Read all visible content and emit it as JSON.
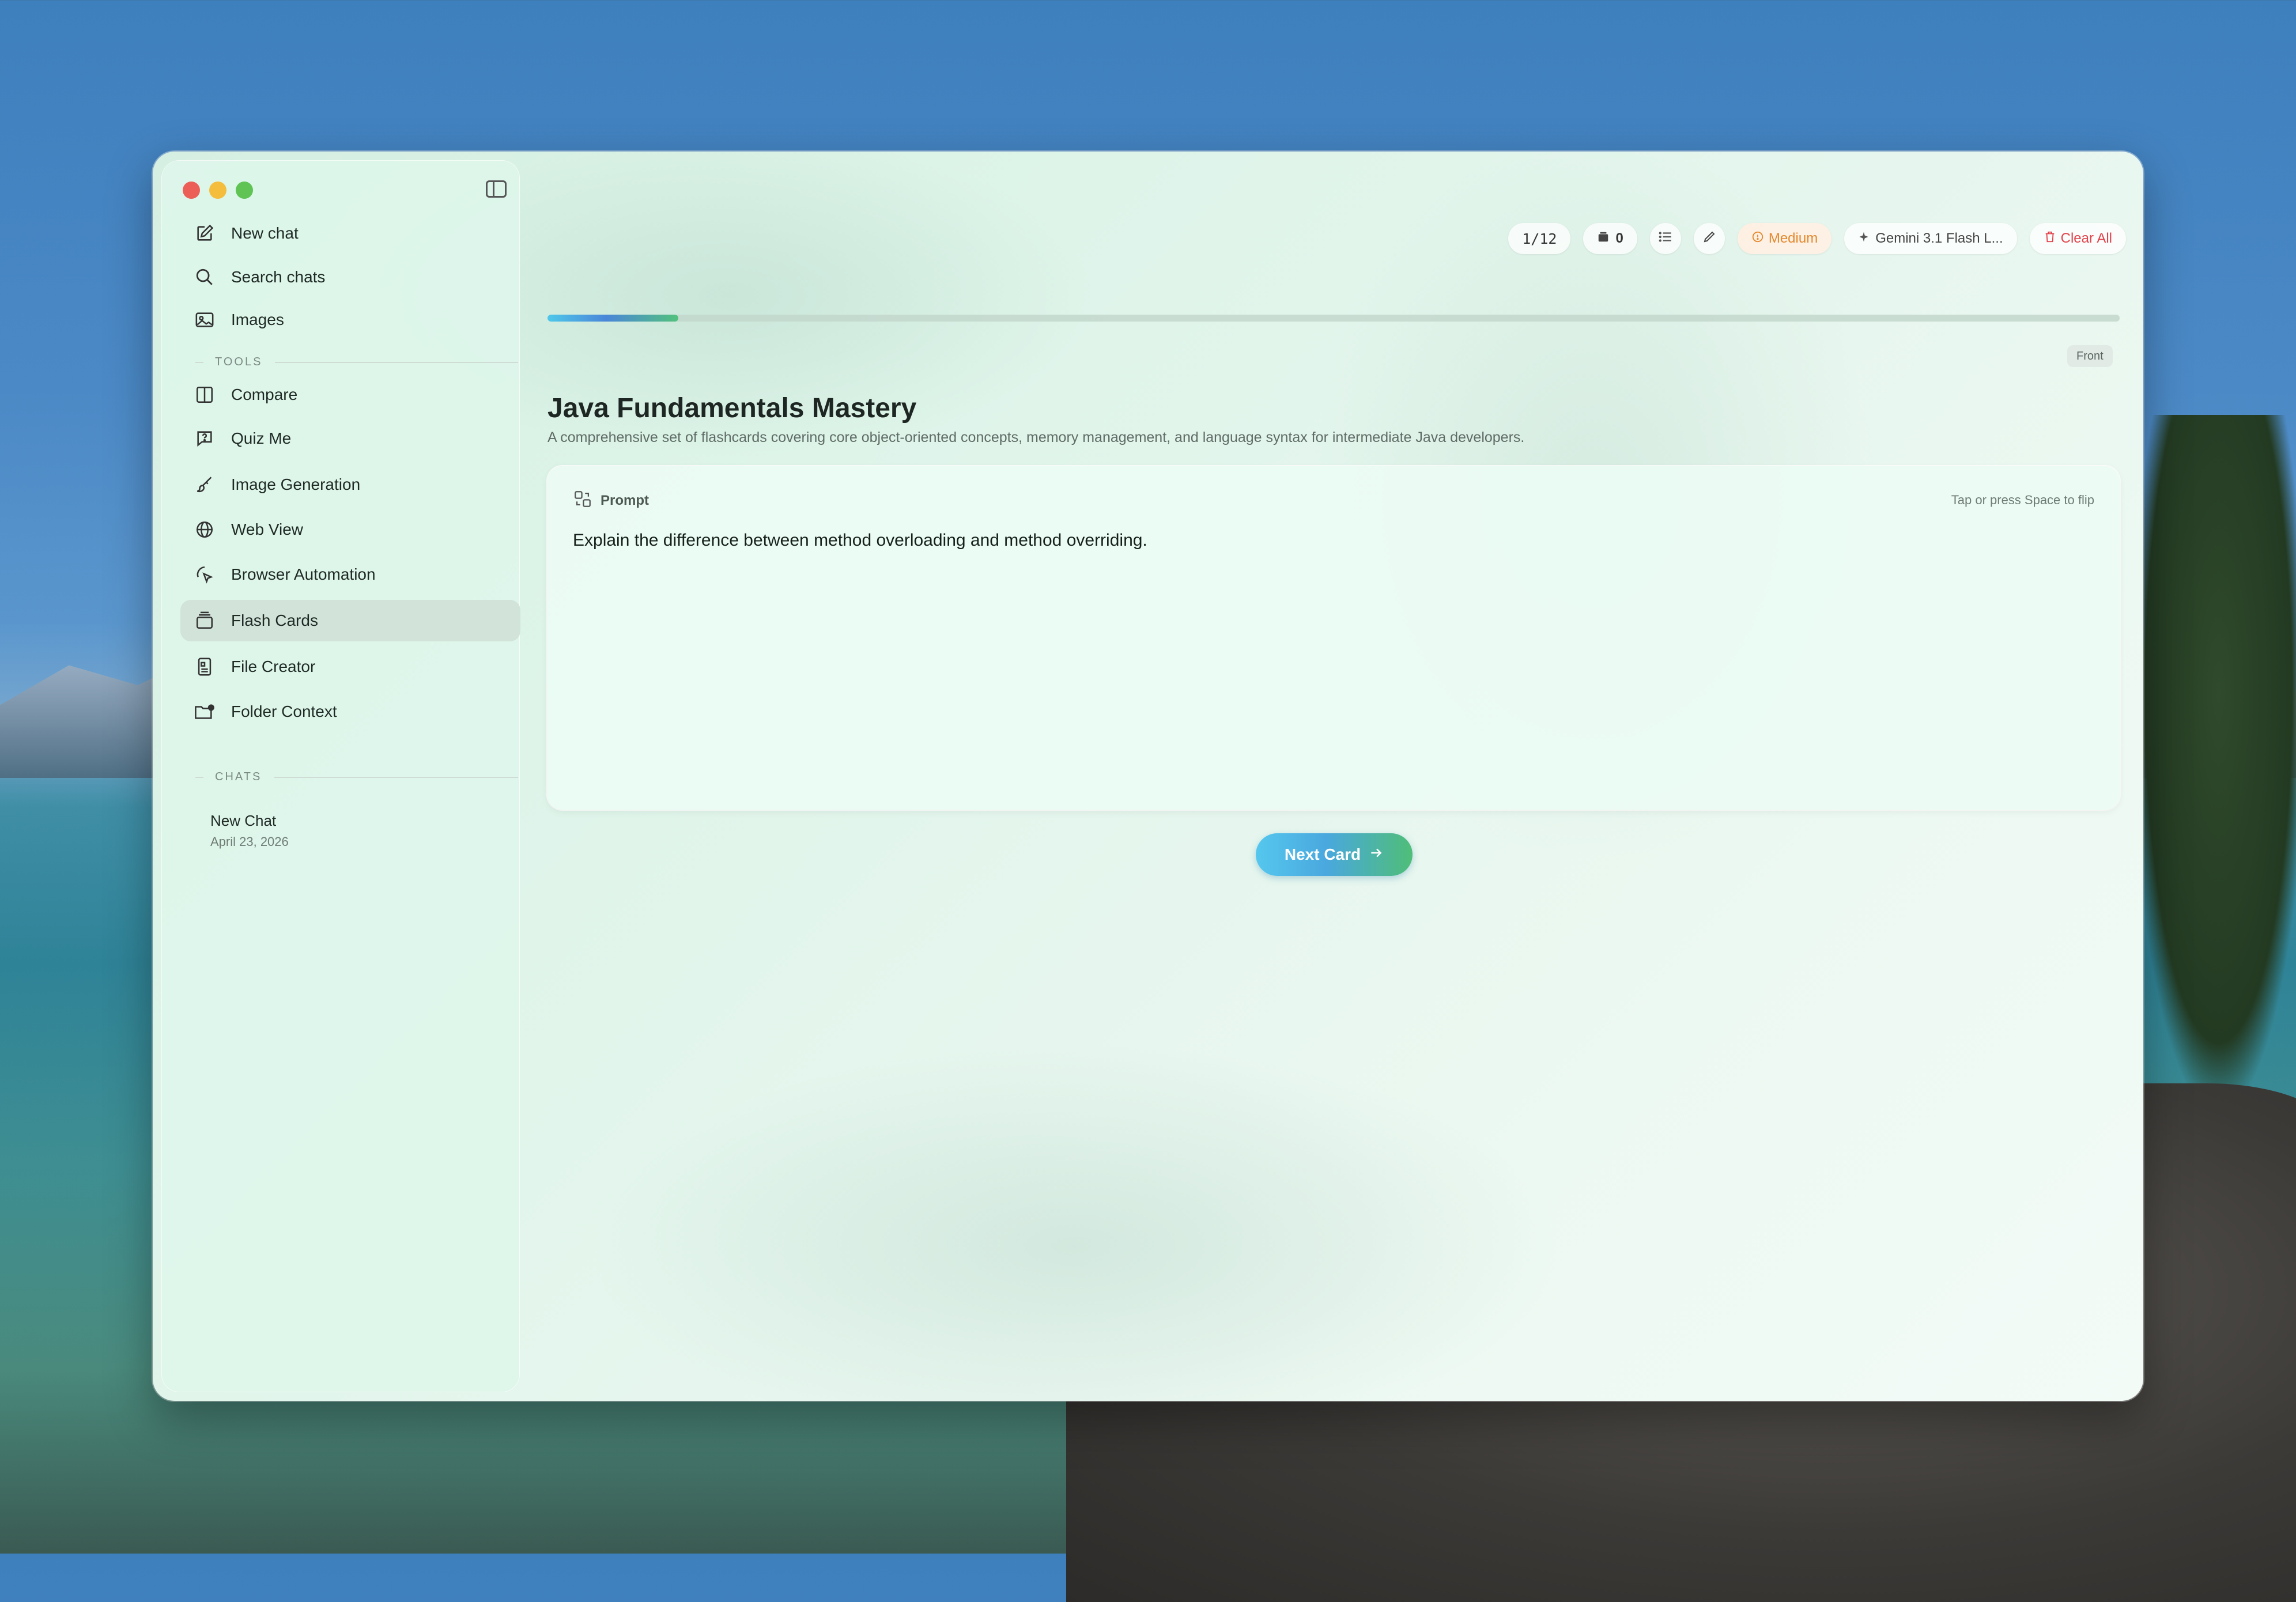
{
  "sidebar": {
    "items": [
      {
        "label": "New chat",
        "icon": "compose-icon"
      },
      {
        "label": "Search chats",
        "icon": "search-icon"
      },
      {
        "label": "Images",
        "icon": "image-icon"
      }
    ],
    "tools_label": "TOOLS",
    "tools": [
      {
        "label": "Compare",
        "icon": "columns-icon"
      },
      {
        "label": "Quiz Me",
        "icon": "question-bubble-icon"
      },
      {
        "label": "Image Generation",
        "icon": "paintbrush-icon"
      },
      {
        "label": "Web View",
        "icon": "globe-icon"
      },
      {
        "label": "Browser Automation",
        "icon": "cursor-click-icon"
      },
      {
        "label": "Flash Cards",
        "icon": "card-stack-icon",
        "active": true
      },
      {
        "label": "File Creator",
        "icon": "document-icon"
      },
      {
        "label": "Folder Context",
        "icon": "folder-badge-icon"
      }
    ],
    "chats_label": "CHATS",
    "chats": [
      {
        "title": "New Chat",
        "date": "April 23, 2026"
      }
    ]
  },
  "toolbar": {
    "card_counter": "1/12",
    "stack_count": "0",
    "difficulty": "Medium",
    "model": "Gemini 3.1 Flash L...",
    "clear_label": "Clear All"
  },
  "progress": {
    "fraction": 0.0833
  },
  "card": {
    "side_badge": "Front",
    "deck_title": "Java Fundamentals Mastery",
    "deck_description": "A comprehensive set of flashcards covering core object-oriented concepts, memory management, and language syntax for intermediate Java developers.",
    "section_label": "Prompt",
    "hint": "Tap or press Space to flip",
    "prompt_text": "Explain the difference between method overloading and method overriding."
  },
  "next_button_label": "Next Card",
  "colors": {
    "accent_start": "#55c7ee",
    "accent_end": "#4fbe78",
    "danger": "#e2424b",
    "warning": "#e4892e"
  }
}
